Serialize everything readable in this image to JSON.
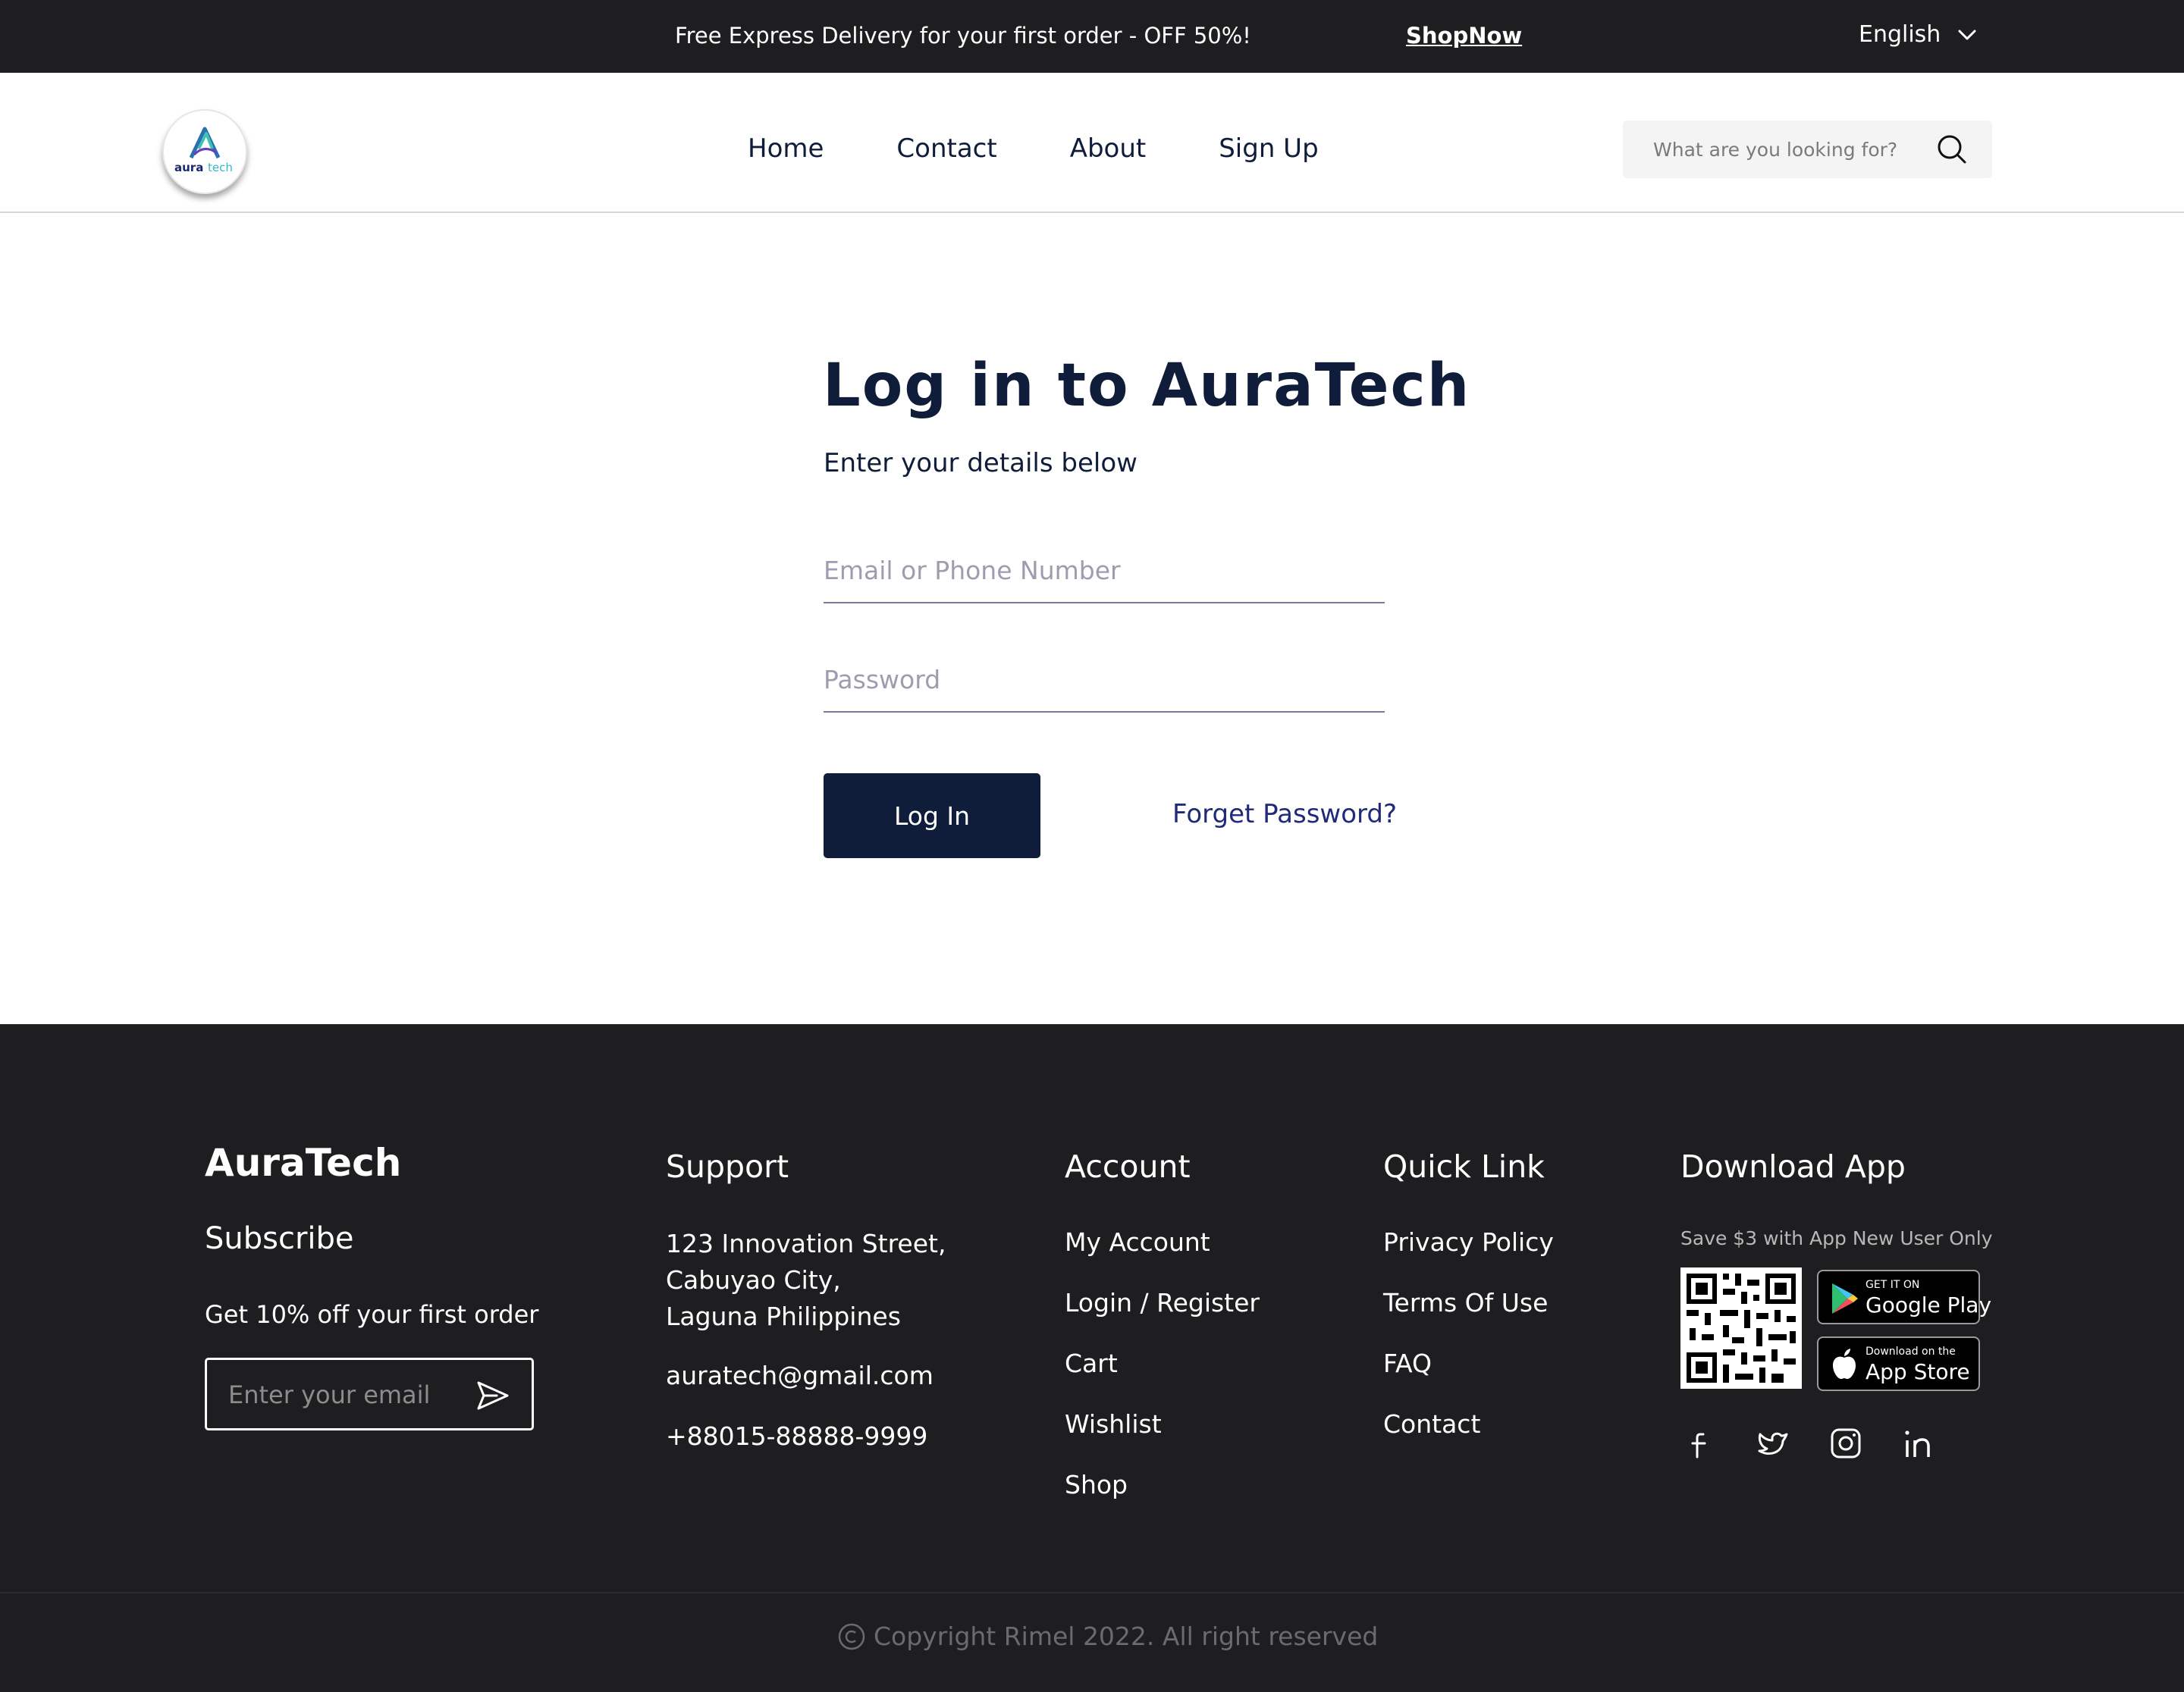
{
  "topbar": {
    "promo": "Free Express Delivery for your first order - OFF 50%!",
    "shop_now": "ShopNow",
    "language": "English"
  },
  "header": {
    "logo_text": "aura tech",
    "nav": [
      "Home",
      "Contact",
      "About",
      "Sign Up"
    ],
    "search_placeholder": "What are you looking for?"
  },
  "login": {
    "title": "Log in to AuraTech",
    "subtitle": "Enter your details below",
    "email_placeholder": "Email or Phone Number",
    "password_placeholder": "Password",
    "login_button": "Log In",
    "forget_password": "Forget Password?"
  },
  "footer": {
    "brand": "AuraTech",
    "subscribe_title": "Subscribe",
    "subscribe_offer": "Get 10% off your first order",
    "email_placeholder": "Enter your email",
    "support": {
      "title": "Support",
      "address_lines": [
        "123 Innovation Street,",
        "Cabuyao City,",
        "Laguna Philippines"
      ],
      "email": "auratech@gmail.com",
      "phone": "+88015-88888-9999"
    },
    "account": {
      "title": "Account",
      "items": [
        "My Account",
        "Login / Register",
        "Cart",
        "Wishlist",
        "Shop"
      ]
    },
    "quick_link": {
      "title": "Quick Link",
      "items": [
        "Privacy Policy",
        "Terms Of Use",
        "FAQ",
        "Contact"
      ]
    },
    "download_app": {
      "title": "Download App",
      "note": "Save $3 with App New User Only",
      "google_play": {
        "small": "GET IT ON",
        "big": "Google Play"
      },
      "app_store": {
        "small": "Download on the",
        "big": "App Store"
      },
      "socials": [
        "facebook-icon",
        "twitter-icon",
        "instagram-icon",
        "linkedin-icon"
      ]
    },
    "copyright": "Copyright Rimel 2022. All right reserved"
  },
  "colors": {
    "dark_bg": "#1e1e20",
    "navy": "#0f1d3a",
    "link": "#1f2a7a"
  }
}
